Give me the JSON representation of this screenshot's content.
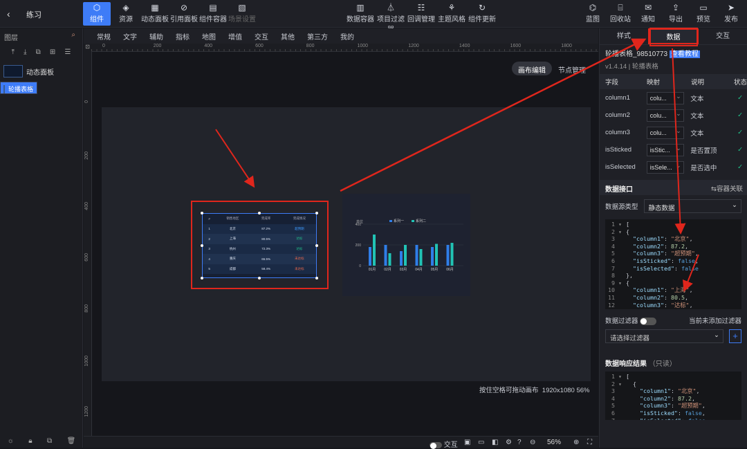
{
  "app": {
    "back": "‹",
    "project": "练习"
  },
  "toolbar": {
    "left": [
      {
        "label": "组件",
        "icon": "cube-icon",
        "active": true
      },
      {
        "label": "资源",
        "icon": "layers-icon"
      },
      {
        "label": "动态面板",
        "icon": "grid-icon"
      },
      {
        "label": "引用面板",
        "icon": "link-icon"
      },
      {
        "label": "组件容器",
        "icon": "container-icon"
      },
      {
        "label": "场景设置",
        "icon": "scene-icon",
        "disabled": true
      }
    ],
    "center": [
      {
        "label": "数据容器",
        "icon": "chart-icon"
      },
      {
        "label": "项目过滤器",
        "icon": "filter-icon"
      },
      {
        "label": "回调管理",
        "icon": "sliders-icon"
      },
      {
        "label": "主题风格",
        "icon": "theme-icon"
      },
      {
        "label": "组件更新",
        "icon": "refresh-icon"
      }
    ],
    "right": [
      {
        "label": "蓝图",
        "icon": "blueprint-icon"
      },
      {
        "label": "回收站",
        "icon": "trash-icon"
      },
      {
        "label": "通知",
        "icon": "message-icon"
      },
      {
        "label": "导出",
        "icon": "export-icon"
      },
      {
        "label": "预览",
        "icon": "preview-icon"
      },
      {
        "label": "发布",
        "icon": "send-icon"
      }
    ]
  },
  "layers": {
    "title": "图层",
    "items": [
      {
        "label": "动态面板",
        "selected": false
      },
      {
        "label": "轮播表格",
        "selected": true
      }
    ]
  },
  "comp_tabs": [
    "常规",
    "文字",
    "辅助",
    "指标",
    "地图",
    "增值",
    "交互",
    "其他",
    "第三方",
    "我的"
  ],
  "ruler": {
    "top": [
      "0",
      "200",
      "400",
      "600",
      "800",
      "1000",
      "1200",
      "1400",
      "1600",
      "1800"
    ],
    "left": [
      "0",
      "200",
      "400",
      "600",
      "800",
      "1000",
      "1200"
    ]
  },
  "canvas": {
    "edit_btn": "画布编辑",
    "node_btn": "节点管理",
    "hint": "按住空格可拖动画布",
    "size": "1920x1080",
    "zoom_pct": "56%"
  },
  "table_widget": {
    "headers": [
      "#",
      "销售地区",
      "完成率",
      "完成情况"
    ],
    "rows": [
      [
        "1",
        "北京",
        "87.2%",
        "超预期"
      ],
      [
        "2",
        "上海",
        "80.5%",
        "达标"
      ],
      [
        "3",
        "杭州",
        "72.3%",
        "达标"
      ],
      [
        "4",
        "重庆",
        "65.5%",
        "未达标"
      ],
      [
        "5",
        "成都",
        "58.4%",
        "未达标"
      ]
    ]
  },
  "chart_data": {
    "type": "bar",
    "title": "",
    "ylabel": "单位",
    "categories": [
      "01月",
      "02月",
      "03月",
      "04月",
      "05月",
      "06月"
    ],
    "series": [
      {
        "name": "系列一",
        "values": [
          180,
          200,
          140,
          200,
          180,
          200
        ]
      },
      {
        "name": "系列二",
        "values": [
          300,
          120,
          200,
          160,
          210,
          220
        ]
      }
    ],
    "ylim": [
      0,
      400
    ],
    "yticks": [
      "0",
      "200",
      "400"
    ],
    "legend": "top-center",
    "colors": [
      "#2f7ee8",
      "#21c3b5"
    ]
  },
  "status": {
    "interact": "交互",
    "zoom": "56%"
  },
  "panel": {
    "tabs": [
      "样式",
      "数据",
      "交互"
    ],
    "active_tab": "数据",
    "name": "轮播表格_98510773",
    "tutorial": "查看教程",
    "version": "v1.4.14 | 轮播表格",
    "fields_head": [
      "字段",
      "映射",
      "说明",
      "状态"
    ],
    "fields": [
      [
        "column1",
        "colu...",
        "文本"
      ],
      [
        "column2",
        "colu...",
        "文本"
      ],
      [
        "column3",
        "colu...",
        "文本"
      ],
      [
        "isSticked",
        "isStic...",
        "是否置顶"
      ],
      [
        "isSelected",
        "isSele...",
        "是否选中"
      ]
    ],
    "api_title": "数据接口",
    "api_link": "⇆容器关联",
    "source_label": "数据源类型",
    "source_value": "静态数据",
    "filter_label": "数据过滤器",
    "filter_note": "当前未添加过滤器",
    "filter_placeholder": "请选择过滤器",
    "result_title": "数据响应结果",
    "result_note": "（只读）"
  }
}
